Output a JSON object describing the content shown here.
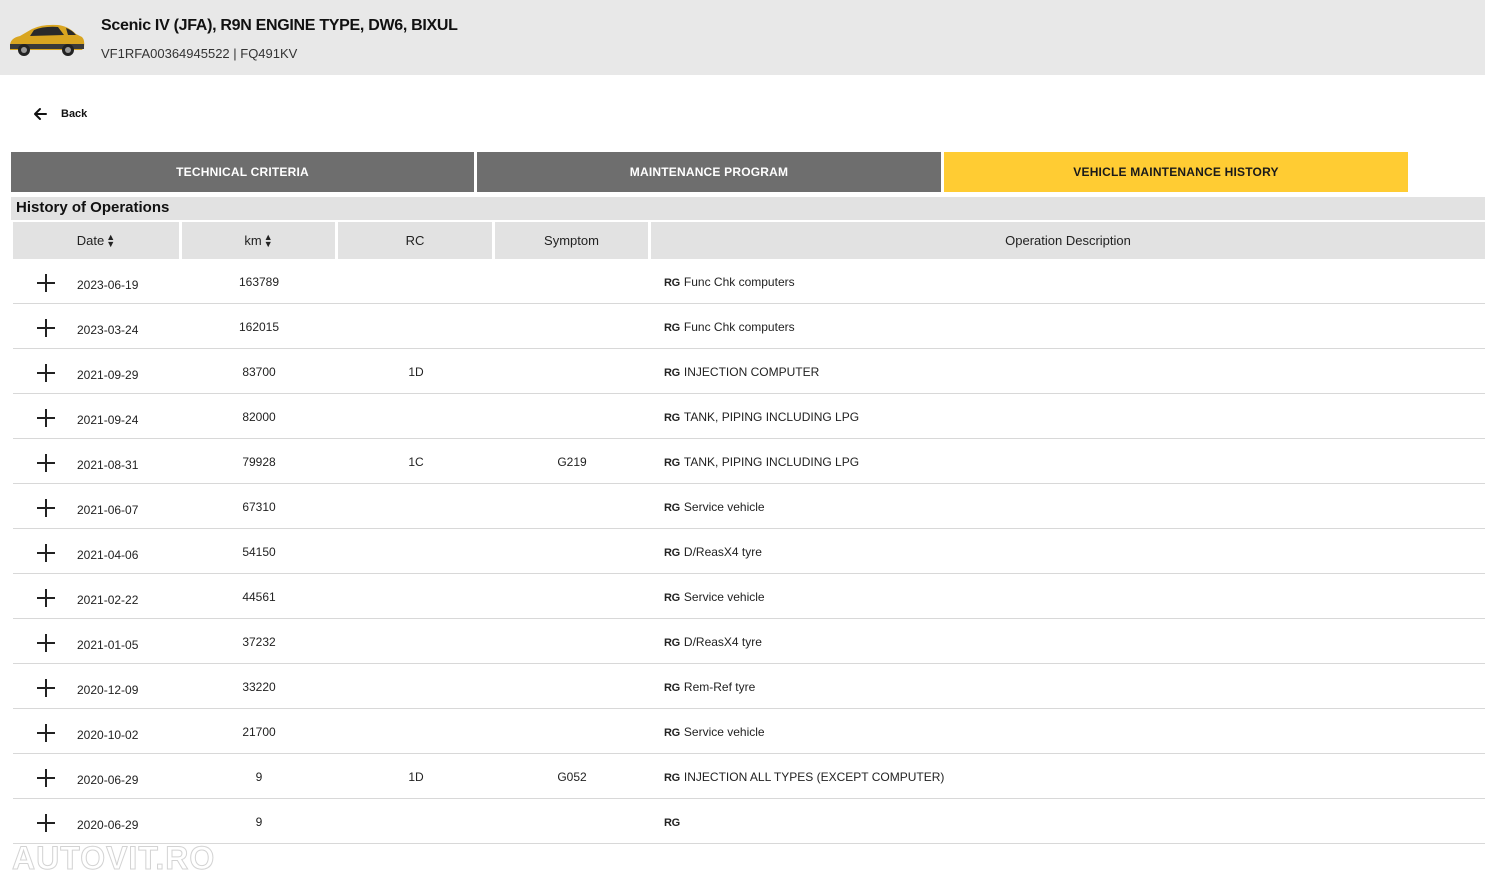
{
  "header": {
    "title": "Scenic IV (JFA), R9N ENGINE TYPE, DW6, BIXUL",
    "subtitle": "VF1RFA00364945522 | FQ491KV"
  },
  "nav": {
    "back_label": "Back"
  },
  "tabs": [
    {
      "label": "TECHNICAL CRITERIA",
      "active": false
    },
    {
      "label": "MAINTENANCE PROGRAM",
      "active": false
    },
    {
      "label": "VEHICLE MAINTENANCE HISTORY",
      "active": true
    }
  ],
  "colors": {
    "accent": "#ffcc33",
    "tab_inactive": "#6e6e6e",
    "header_bg": "#e8e8e8"
  },
  "section": {
    "title": "History of Operations"
  },
  "table": {
    "columns": [
      "Date",
      "km",
      "RC",
      "Symptom",
      "Operation Description"
    ],
    "rows": [
      {
        "date": "2023-06-19",
        "km": "163789",
        "rc": "",
        "symptom": "",
        "rg": "RG",
        "desc": "Func Chk computers"
      },
      {
        "date": "2023-03-24",
        "km": "162015",
        "rc": "",
        "symptom": "",
        "rg": "RG",
        "desc": "Func Chk computers"
      },
      {
        "date": "2021-09-29",
        "km": "83700",
        "rc": "1D",
        "symptom": "",
        "rg": "RG",
        "desc": "INJECTION COMPUTER"
      },
      {
        "date": "2021-09-24",
        "km": "82000",
        "rc": "",
        "symptom": "",
        "rg": "RG",
        "desc": "TANK, PIPING INCLUDING LPG"
      },
      {
        "date": "2021-08-31",
        "km": "79928",
        "rc": "1C",
        "symptom": "G219",
        "rg": "RG",
        "desc": "TANK, PIPING INCLUDING LPG"
      },
      {
        "date": "2021-06-07",
        "km": "67310",
        "rc": "",
        "symptom": "",
        "rg": "RG",
        "desc": "Service vehicle"
      },
      {
        "date": "2021-04-06",
        "km": "54150",
        "rc": "",
        "symptom": "",
        "rg": "RG",
        "desc": "D/ReasX4 tyre"
      },
      {
        "date": "2021-02-22",
        "km": "44561",
        "rc": "",
        "symptom": "",
        "rg": "RG",
        "desc": "Service vehicle"
      },
      {
        "date": "2021-01-05",
        "km": "37232",
        "rc": "",
        "symptom": "",
        "rg": "RG",
        "desc": "D/ReasX4 tyre"
      },
      {
        "date": "2020-12-09",
        "km": "33220",
        "rc": "",
        "symptom": "",
        "rg": "RG",
        "desc": "Rem-Ref tyre"
      },
      {
        "date": "2020-10-02",
        "km": "21700",
        "rc": "",
        "symptom": "",
        "rg": "RG",
        "desc": "Service vehicle"
      },
      {
        "date": "2020-06-29",
        "km": "9",
        "rc": "1D",
        "symptom": "G052",
        "rg": "RG",
        "desc": "INJECTION ALL TYPES (EXCEPT COMPUTER)"
      },
      {
        "date": "2020-06-29",
        "km": "9",
        "rc": "",
        "symptom": "",
        "rg": "RG",
        "desc": ""
      }
    ]
  },
  "watermark": "AUTOVIT.RO"
}
